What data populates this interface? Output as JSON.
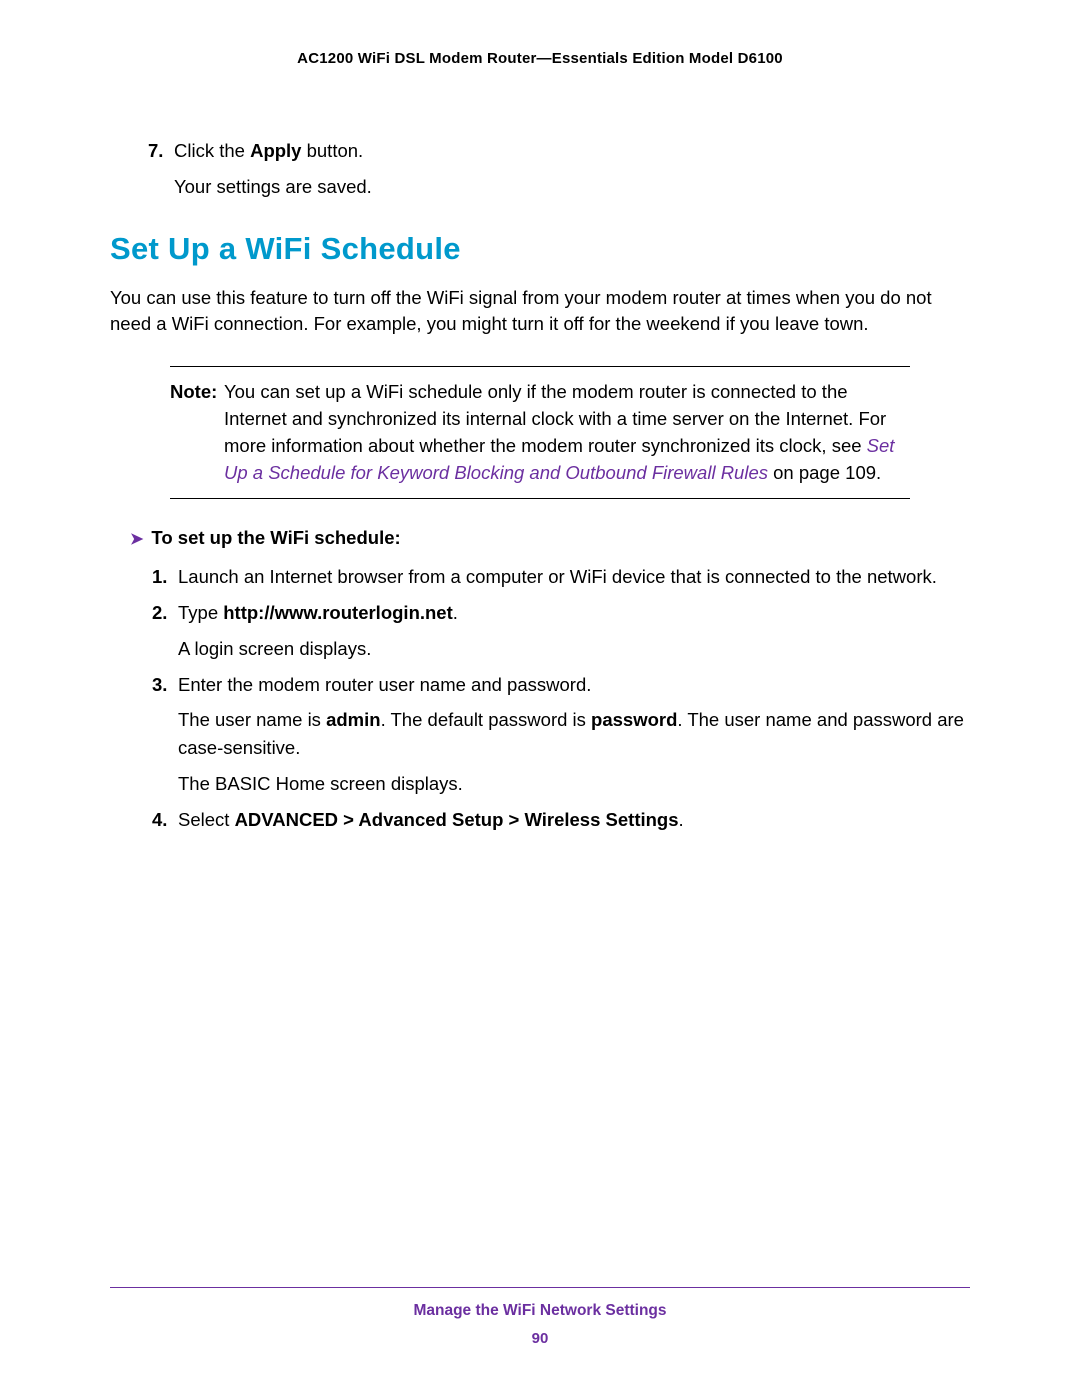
{
  "header": "AC1200 WiFi DSL Modem Router—Essentials Edition Model D6100",
  "top_steps": {
    "num": "7.",
    "pre": "Click the ",
    "bold": "Apply",
    "post": " button.",
    "sub": "Your settings are saved."
  },
  "section_heading": "Set Up a WiFi Schedule",
  "intro": "You can use this feature to turn off the WiFi signal from your modem router at times when you do not need a WiFi connection. For example, you might turn it off for the weekend if you leave town.",
  "note": {
    "label": "Note:",
    "pre": "You can set up a WiFi schedule only if the modem router is connected to the Internet and synchronized its internal clock with a time server on the Internet. For more information about whether the modem router synchronized its clock, see ",
    "link": "Set Up a Schedule for Keyword Blocking and Outbound Firewall Rules",
    "post": " on page 109."
  },
  "proc_heading": "To set up the WiFi schedule:",
  "steps": {
    "s1": {
      "num": "1.",
      "text": "Launch an Internet browser from a computer or WiFi device that is connected to the network."
    },
    "s2": {
      "num": "2.",
      "pre": "Type ",
      "bold": "http://www.routerlogin.net",
      "post": ".",
      "sub": "A login screen displays."
    },
    "s3": {
      "num": "3.",
      "text": "Enter the modem router user name and password.",
      "sub1_pre": "The user name is ",
      "sub1_b1": "admin",
      "sub1_mid": ". The default password is ",
      "sub1_b2": "password",
      "sub1_post": ". The user name and password are case-sensitive.",
      "sub2": "The BASIC Home screen displays."
    },
    "s4": {
      "num": "4.",
      "pre": "Select ",
      "bold": "ADVANCED > Advanced Setup > Wireless Settings",
      "post": "."
    }
  },
  "footer": {
    "title": "Manage the WiFi Network Settings",
    "page": "90"
  }
}
